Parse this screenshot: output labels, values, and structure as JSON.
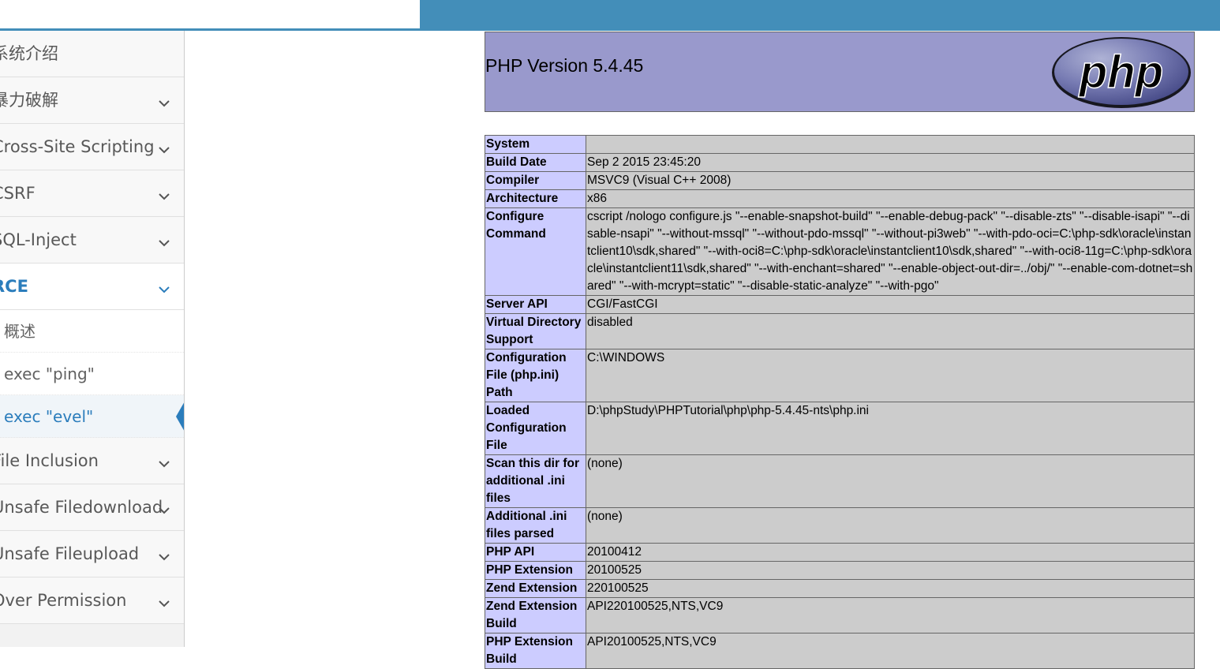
{
  "sidebar": {
    "items": [
      {
        "label": "系统介绍",
        "has_chevron": false
      },
      {
        "label": "暴力破解",
        "has_chevron": true
      },
      {
        "label": "Cross-Site Scripting",
        "has_chevron": true
      },
      {
        "label": "CSRF",
        "has_chevron": true
      },
      {
        "label": "SQL-Inject",
        "has_chevron": true
      },
      {
        "label": "RCE",
        "has_chevron": true,
        "open": true
      },
      {
        "label": "File Inclusion",
        "has_chevron": true
      },
      {
        "label": "Unsafe Filedownload",
        "has_chevron": true
      },
      {
        "label": "Unsafe Fileupload",
        "has_chevron": true
      },
      {
        "label": "Over Permission",
        "has_chevron": true
      }
    ],
    "rce_subitems": [
      {
        "label": "概述"
      },
      {
        "label": "exec \"ping\""
      },
      {
        "label": "exec \"evel\"",
        "active": true
      }
    ]
  },
  "phpinfo": {
    "version": "PHP Version 5.4.45",
    "logo_text": "php",
    "rows": [
      {
        "key": "System",
        "value": ""
      },
      {
        "key": "Build Date",
        "value": "Sep 2 2015 23:45:20"
      },
      {
        "key": "Compiler",
        "value": "MSVC9 (Visual C++ 2008)"
      },
      {
        "key": "Architecture",
        "value": "x86"
      },
      {
        "key": "Configure Command",
        "value": "cscript /nologo configure.js \"--enable-snapshot-build\" \"--enable-debug-pack\" \"--disable-zts\" \"--disable-isapi\" \"--disable-nsapi\" \"--without-mssql\" \"--without-pdo-mssql\" \"--without-pi3web\" \"--with-pdo-oci=C:\\php-sdk\\oracle\\instantclient10\\sdk,shared\" \"--with-oci8=C:\\php-sdk\\oracle\\instantclient10\\sdk,shared\" \"--with-oci8-11g=C:\\php-sdk\\oracle\\instantclient11\\sdk,shared\" \"--with-enchant=shared\" \"--enable-object-out-dir=../obj/\" \"--enable-com-dotnet=shared\" \"--with-mcrypt=static\" \"--disable-static-analyze\" \"--with-pgo\""
      },
      {
        "key": "Server API",
        "value": "CGI/FastCGI"
      },
      {
        "key": "Virtual Directory Support",
        "value": "disabled"
      },
      {
        "key": "Configuration File (php.ini) Path",
        "value": "C:\\WINDOWS"
      },
      {
        "key": "Loaded Configuration File",
        "value": "D:\\phpStudy\\PHPTutorial\\php\\php-5.4.45-nts\\php.ini"
      },
      {
        "key": "Scan this dir for additional .ini files",
        "value": "(none)"
      },
      {
        "key": "Additional .ini files parsed",
        "value": "(none)"
      },
      {
        "key": "PHP API",
        "value": "20100412"
      },
      {
        "key": "PHP Extension",
        "value": "20100525"
      },
      {
        "key": "Zend Extension",
        "value": "220100525"
      },
      {
        "key": "Zend Extension Build",
        "value": "API220100525,NTS,VC9"
      },
      {
        "key": "PHP Extension Build",
        "value": "API20100525,NTS,VC9"
      }
    ]
  },
  "colors": {
    "accent": "#438eb9",
    "php_header": "#9999cc",
    "key_cell": "#ccccff",
    "value_cell": "#cccccc"
  }
}
